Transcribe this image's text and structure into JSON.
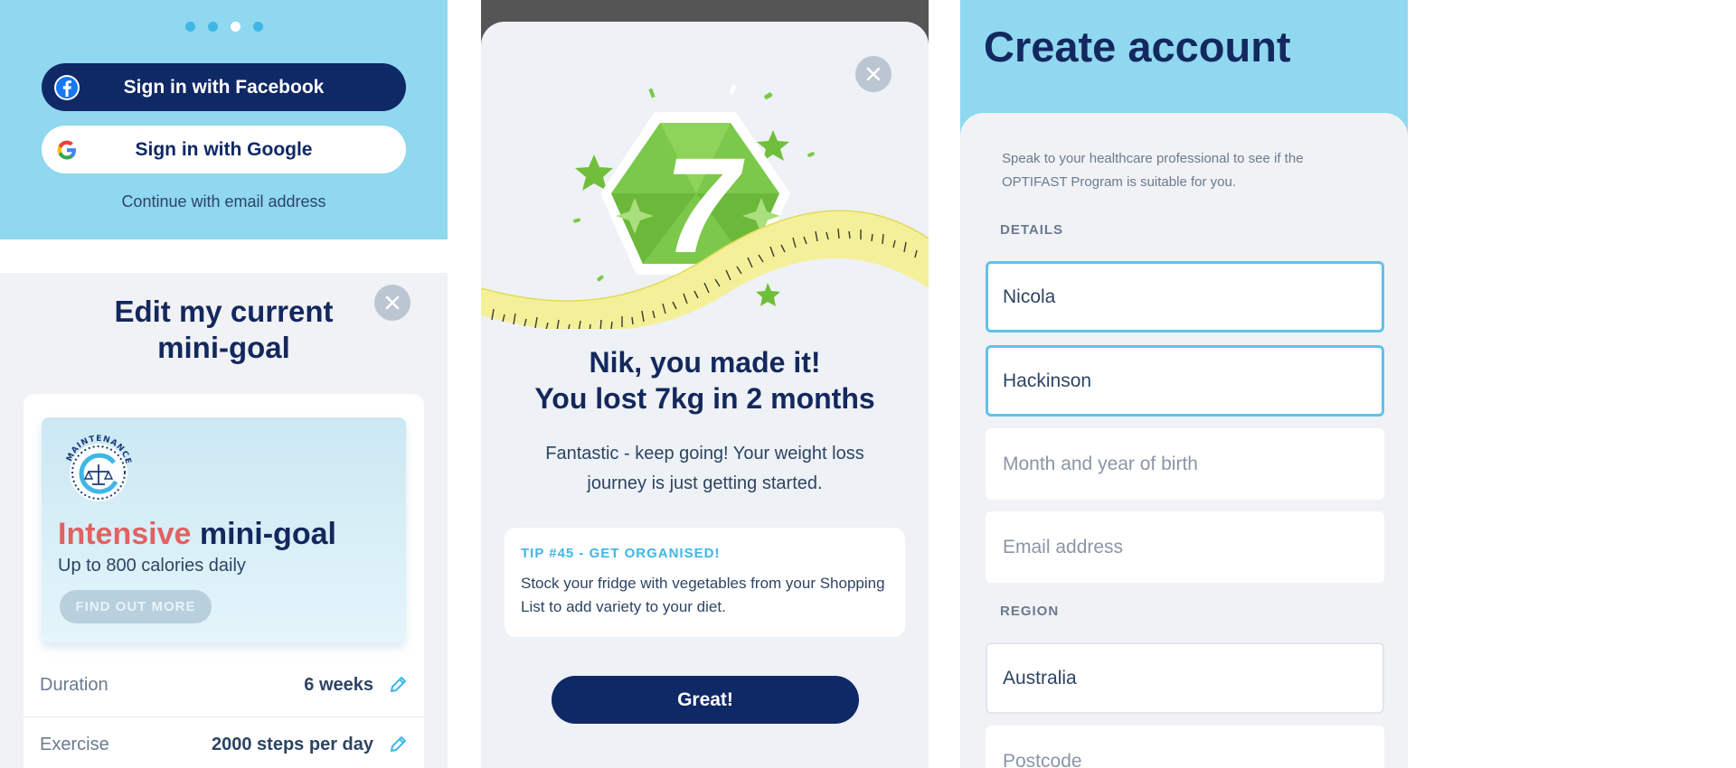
{
  "signin": {
    "carousel": {
      "total": 4,
      "active_index": 2
    },
    "facebook_button": "Sign in with Facebook",
    "google_button": "Sign in with Google",
    "email_link": "Continue with email address"
  },
  "minigoal": {
    "title_line1": "Edit my current",
    "title_line2": "mini-goal",
    "badge_text": "MAINTENANCE",
    "goal_highlight": "Intensive",
    "goal_rest": "mini-goal",
    "goal_subtitle": "Up to 800 calories daily",
    "find_out_more": "FIND OUT MORE",
    "rows": [
      {
        "label": "Duration",
        "value": "6 weeks"
      },
      {
        "label": "Exercise",
        "value": "2000 steps per day"
      }
    ]
  },
  "achievement": {
    "badge_number": "7",
    "heading_line1": "Nik, you made it!",
    "heading_line2": "You lost 7kg in 2 months",
    "body": "Fantastic - keep going!  Your weight loss journey is just getting started.",
    "tip_title": "TIP #45 - GET ORGANISED!",
    "tip_body": "Stock your fridge with vegetables from your Shopping List to add variety to your diet.",
    "button": "Great!"
  },
  "create_account": {
    "title": "Create account",
    "note": "Speak to your healthcare professional to see if the OPTIFAST Program is suitable for you.",
    "details_label": "DETAILS",
    "first_name": "Nicola",
    "last_name": "Hackinson",
    "birth_placeholder": "Month and year of birth",
    "email_placeholder": "Email address",
    "region_label": "REGION",
    "region_value": "Australia",
    "postcode_placeholder": "Postcode"
  },
  "colors": {
    "navy": "#0f2866",
    "sky": "#8fd8ef",
    "accent_blue": "#3fb6e6",
    "intensive_red": "#e06262",
    "badge_green": "#7cc84a",
    "tape_yellow": "#f4f09a"
  },
  "icons": [
    "facebook-icon",
    "google-icon",
    "close-icon",
    "pencil-icon",
    "maintenance-badge-icon",
    "achievement-badge-icon"
  ]
}
